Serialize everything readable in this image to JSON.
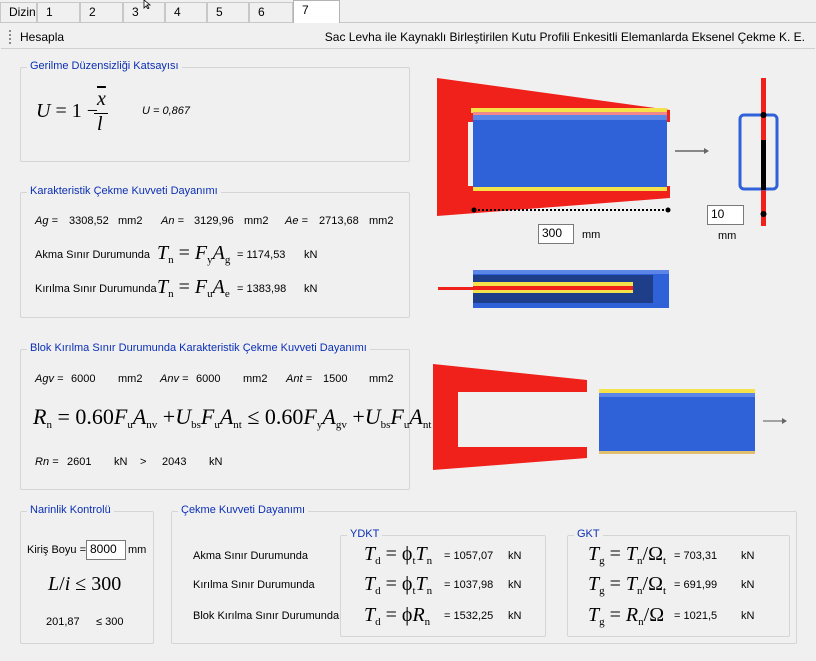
{
  "tabs": [
    "Dizin",
    "1",
    "2",
    "3",
    "4",
    "5",
    "6",
    "7"
  ],
  "active_tab": "7",
  "toolbar": {
    "hesapla_label": "Hesapla",
    "title": "Sac Levha ile Kaynaklı Birleştirilen Kutu Profili Enkesitli Elemanlarda Eksenel Çekme K. E."
  },
  "gerilme": {
    "title": "Gerilme Düzensizliği Katsayısı",
    "u_label": "U = 0,867",
    "f_u": "U",
    "f_eq": "= 1 −",
    "f_x": "x",
    "f_l": "l"
  },
  "karakteristik": {
    "title": "Karakteristik Çekme Kuvveti Dayanımı",
    "ag_label": "Ag =",
    "ag_value": "3308,52",
    "ag_unit": "mm2",
    "an_label": "An =",
    "an_value": "3129,96",
    "an_unit": "mm2",
    "ae_label": "Ae =",
    "ae_value": "2713,68",
    "ae_unit": "mm2",
    "akma_label": "Akma Sınır Durumunda",
    "akma_value": "= 1174,53",
    "akma_unit": "kN",
    "kirilma_label": "Kırılma Sınır Durumunda",
    "kirilma_value": "= 1383,98",
    "kirilma_unit": "kN"
  },
  "blok": {
    "title": "Blok Kırılma Sınır Durumunda Karakteristik Çekme Kuvveti Dayanımı",
    "agv_label": "Agv =",
    "agv_value": "6000",
    "agv_unit": "mm2",
    "anv_label": "Anv =",
    "anv_value": "6000",
    "anv_unit": "mm2",
    "ant_label": "Ant =",
    "ant_value": "1500",
    "ant_unit": "mm2",
    "rn_label": "Rn =",
    "rn_value": "2601",
    "rn_unit": "kN",
    "gt": ">",
    "cap_value": "2043",
    "cap_unit": "kN"
  },
  "narinlik": {
    "title": "Narinlik Kontrolü",
    "kiris_label": "Kiriş Boyu =",
    "kiris_value": "8000",
    "kiris_unit": "mm",
    "ratio_value": "201,87",
    "limit": "≤ 300"
  },
  "cekme": {
    "title": "Çekme Kuvveti Dayanımı",
    "rows": [
      "Akma Sınır Durumunda",
      "Kırılma Sınır Durumunda",
      "Blok Kırılma Sınır Durumunda"
    ],
    "ydkt": {
      "title": "YDKT",
      "values": [
        "= 1057,07",
        "= 1037,98",
        "= 1532,25"
      ],
      "unit": "kN"
    },
    "gkt": {
      "title": "GKT",
      "values": [
        "= 703,31",
        "= 691,99",
        "= 1021,5"
      ],
      "unit": "kN"
    }
  },
  "diagram": {
    "length_value": "300",
    "length_unit": "mm",
    "weld_value": "10",
    "weld_unit": "mm"
  },
  "colors": {
    "plate": "#f01a1a",
    "profile": "#2f62d8",
    "weld": "#f5e14a",
    "accent": "#0b2fb5"
  }
}
